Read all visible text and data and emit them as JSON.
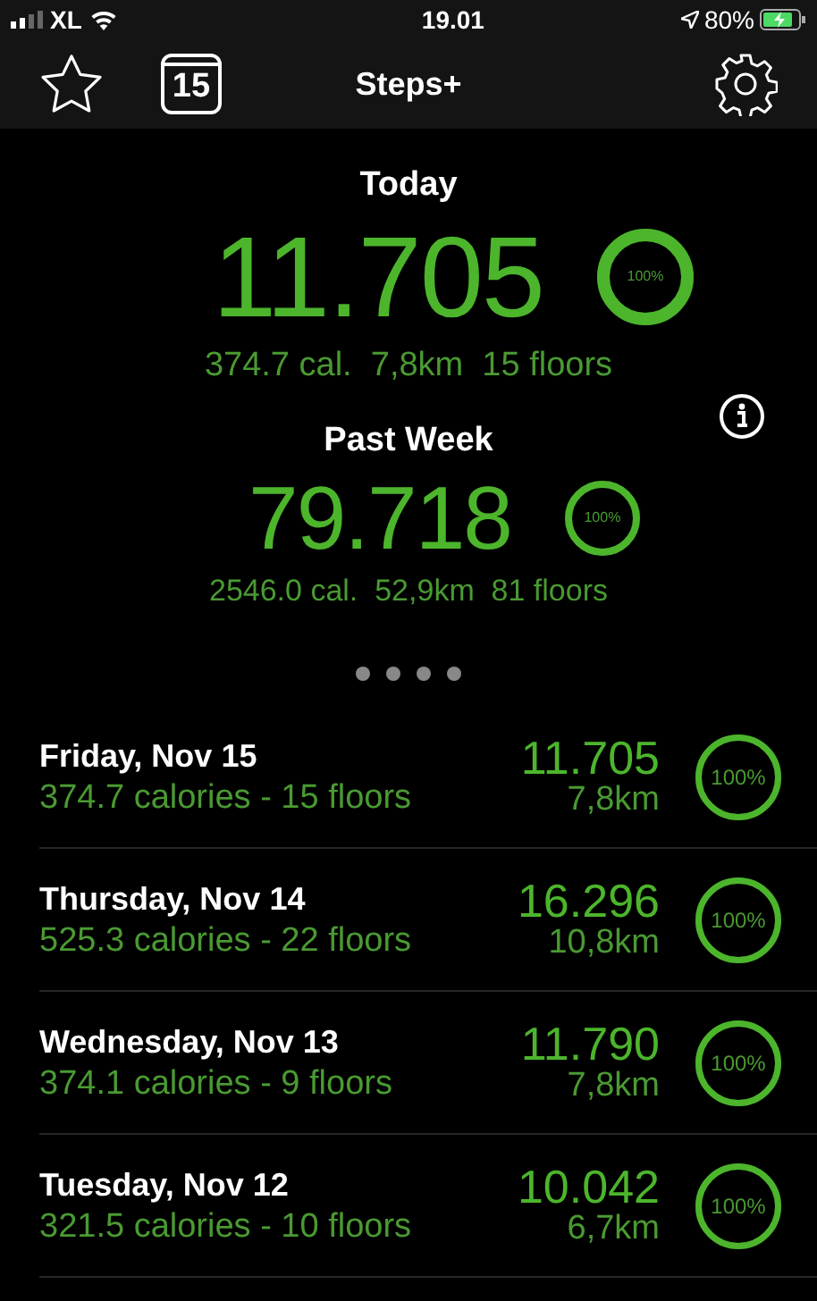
{
  "status_bar": {
    "carrier": "XL",
    "time": "19.01",
    "battery": "80%"
  },
  "nav": {
    "calendar_day": "15",
    "title": "Steps+"
  },
  "summaries": [
    {
      "heading": "Today",
      "steps": "11.705",
      "ring_label": "100%",
      "level": 1,
      "details": "374.7 cal.  7,8km  15 floors",
      "kind": "primary"
    },
    {
      "heading": "Past Week",
      "steps": "79.718",
      "ring_label": "100%",
      "level": 1,
      "details": "2546.0 cal.  52,9km  81 floors",
      "kind": "secondary"
    }
  ],
  "days": [
    {
      "date": "Friday, Nov 15",
      "details": "374.7 calories - 15 floors",
      "steps": "11.705",
      "distance": "7,8km",
      "ring_label": "100%",
      "level": 1
    },
    {
      "date": "Thursday, Nov 14",
      "details": "525.3 calories - 22 floors",
      "steps": "16.296",
      "distance": "10,8km",
      "ring_label": "100%",
      "level": 1
    },
    {
      "date": "Wednesday, Nov 13",
      "details": "374.1 calories - 9 floors",
      "steps": "11.790",
      "distance": "7,8km",
      "ring_label": "100%",
      "level": 1
    },
    {
      "date": "Tuesday, Nov 12",
      "details": "321.5 calories - 10 floors",
      "steps": "10.042",
      "distance": "6,7km",
      "ring_label": "100%",
      "level": 1
    }
  ]
}
